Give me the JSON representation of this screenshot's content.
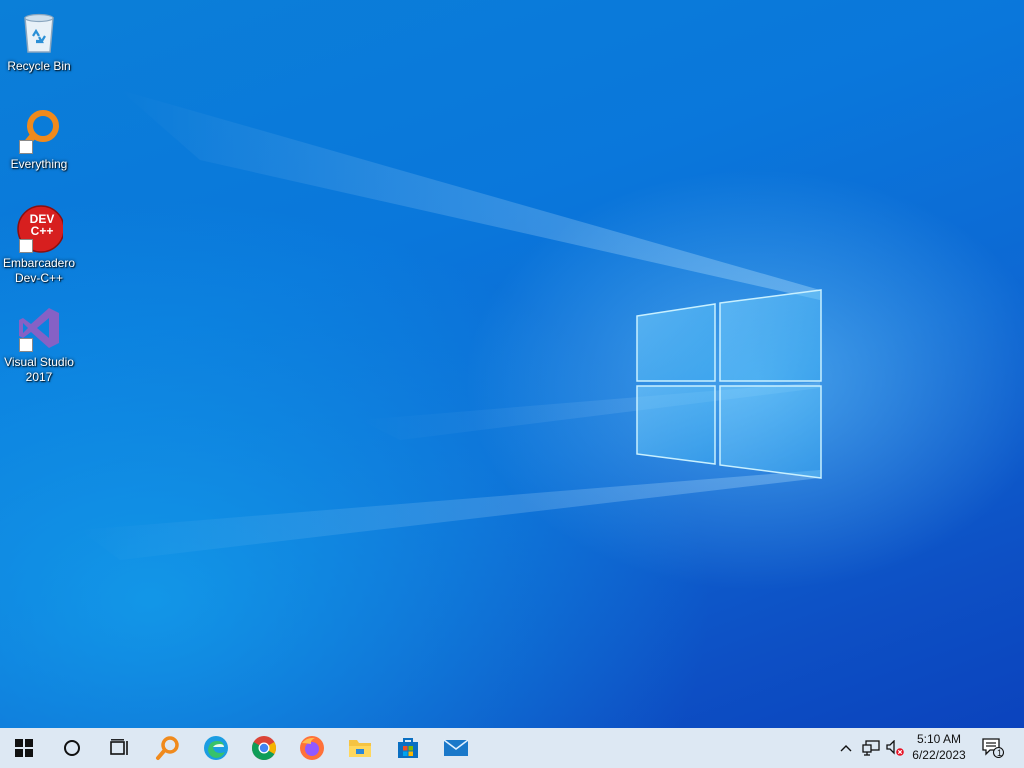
{
  "desktop": {
    "icons": [
      {
        "label": "Recycle Bin"
      },
      {
        "label": "Everything"
      },
      {
        "label": "Embarcadero Dev-C++",
        "badge_text": "DEV C++"
      },
      {
        "label": "Visual Studio 2017"
      }
    ]
  },
  "taskbar": {
    "apps": [
      "start-icon",
      "cortana-icon",
      "task-view-icon",
      "everything-icon",
      "edge-icon",
      "chrome-icon",
      "firefox-icon",
      "file-explorer-icon",
      "store-icon",
      "mail-icon"
    ],
    "tray": {
      "time": "5:10 AM",
      "date": "6/22/2023",
      "notification_count": "1"
    }
  },
  "colors": {
    "taskbar": "#dde8f3",
    "wallpaper_accent": "#0a77db"
  }
}
